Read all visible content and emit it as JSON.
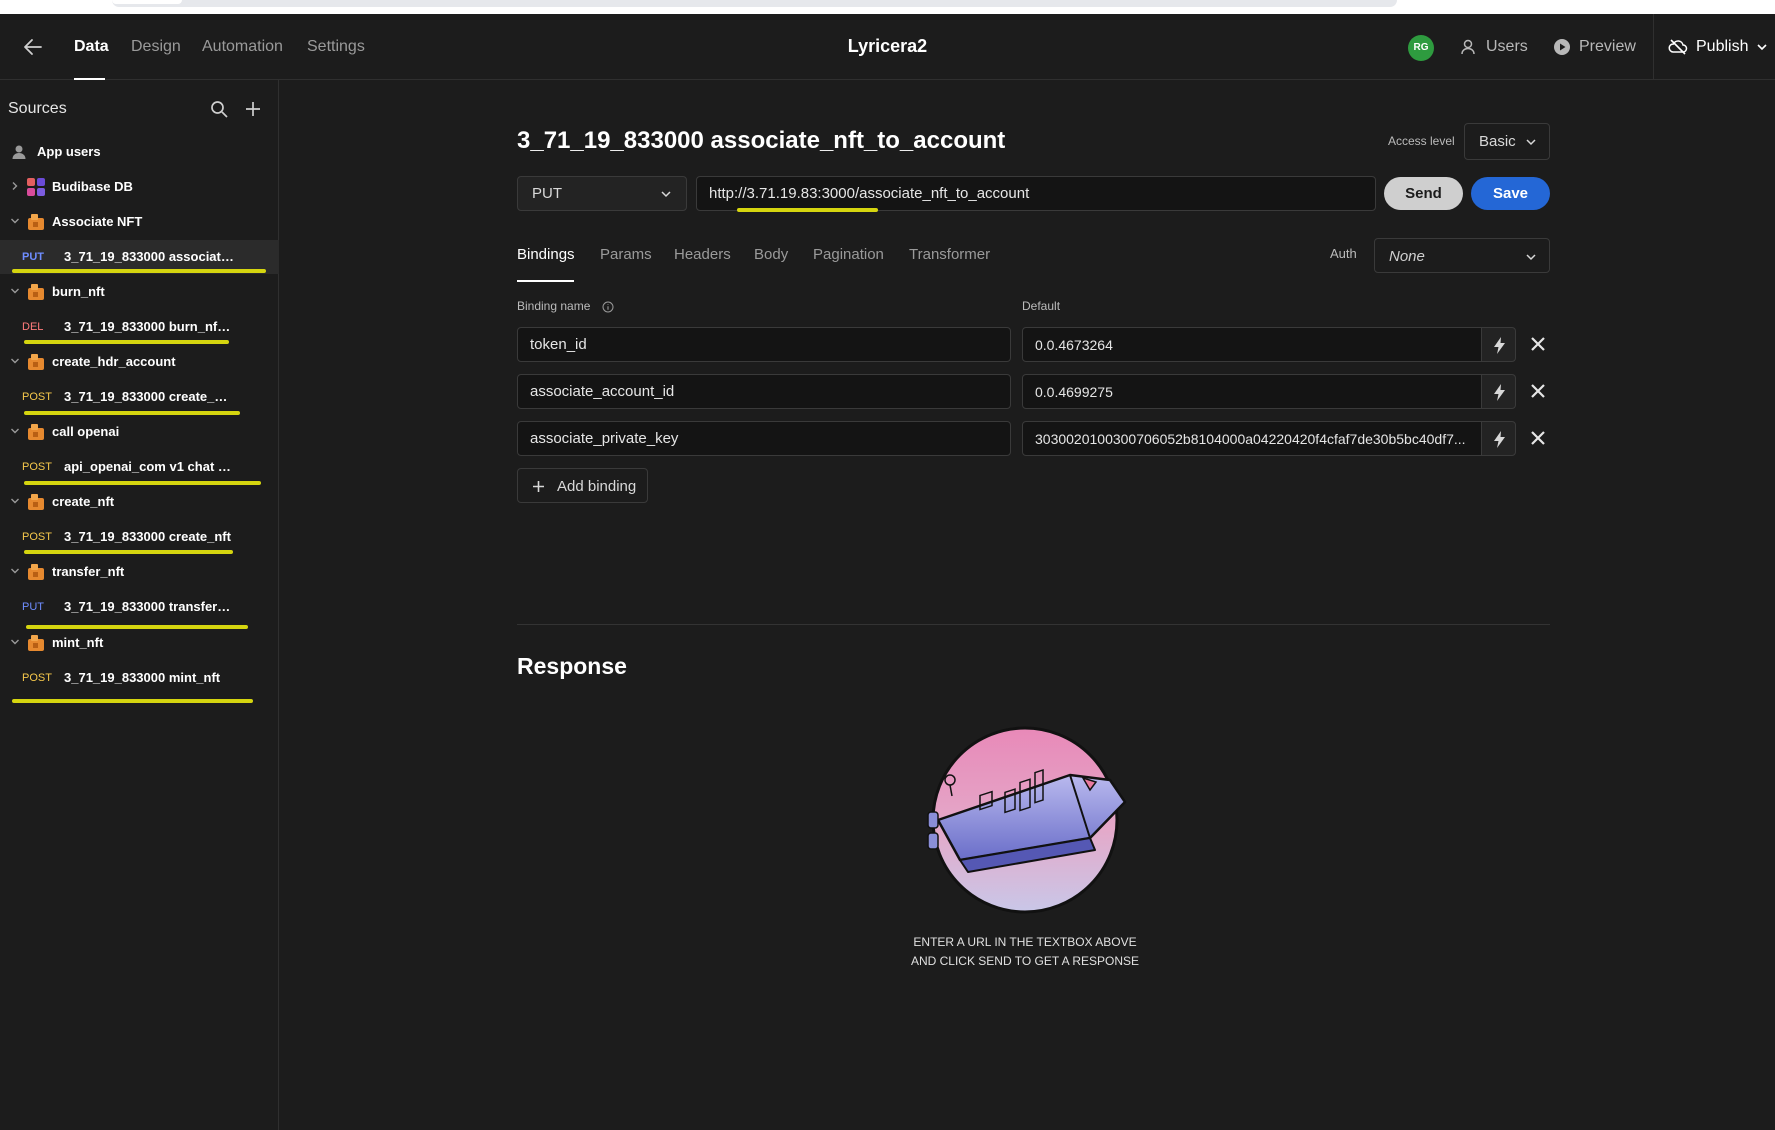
{
  "header": {
    "tabs": [
      "Data",
      "Design",
      "Automation",
      "Settings"
    ],
    "active_tab": "Data",
    "app_title": "Lyricera2",
    "avatar_initials": "RG",
    "users_label": "Users",
    "preview_label": "Preview",
    "publish_label": "Publish"
  },
  "sidebar": {
    "title": "Sources",
    "app_users": "App users",
    "datasources": [
      {
        "name": "Budibase DB",
        "expanded": false
      },
      {
        "name": "Associate NFT",
        "expanded": true,
        "query": {
          "method": "PUT",
          "name": "3_71_19_833000 associate..."
        }
      },
      {
        "name": "burn_nft",
        "expanded": true,
        "query": {
          "method": "DEL",
          "name": "3_71_19_833000 burn_nft_..."
        }
      },
      {
        "name": "create_hdr_account",
        "expanded": true,
        "query": {
          "method": "POST",
          "name": "3_71_19_833000 create_ac..."
        }
      },
      {
        "name": "call openai",
        "expanded": true,
        "query": {
          "method": "POST",
          "name": "api_openai_com v1 chat co..."
        }
      },
      {
        "name": "create_nft",
        "expanded": true,
        "query": {
          "method": "POST",
          "name": "3_71_19_833000 create_nft"
        }
      },
      {
        "name": "transfer_nft",
        "expanded": true,
        "query": {
          "method": "PUT",
          "name": "3_71_19_833000 transfer_n..."
        }
      },
      {
        "name": "mint_nft",
        "expanded": true,
        "query": {
          "method": "POST",
          "name": "3_71_19_833000 mint_nft"
        }
      }
    ]
  },
  "query": {
    "title": "3_71_19_833000 associate_nft_to_account",
    "access_level_label": "Access level",
    "access_level": "Basic",
    "method": "PUT",
    "url": "http://3.71.19.83:3000/associate_nft_to_account",
    "send_label": "Send",
    "save_label": "Save",
    "tabs": [
      "Bindings",
      "Params",
      "Headers",
      "Body",
      "Pagination",
      "Transformer"
    ],
    "active_tab": "Bindings",
    "auth_label": "Auth",
    "auth_value": "None",
    "binding_name_header": "Binding name",
    "default_header": "Default",
    "bindings": [
      {
        "name": "token_id",
        "default": "0.0.4673264"
      },
      {
        "name": "associate_account_id",
        "default": "0.0.4699275"
      },
      {
        "name": "associate_private_key",
        "default": "3030020100300706052b8104000a04220420f4cfaf7de30b5bc40df7..."
      }
    ],
    "add_binding_label": "Add binding"
  },
  "response": {
    "title": "Response",
    "empty_line1": "ENTER A URL IN THE TEXTBOX ABOVE",
    "empty_line2": "AND CLICK SEND TO GET A RESPONSE"
  },
  "colors": {
    "background": "#1c1c1c",
    "primary_button": "#2467d6",
    "method_put": "#6f8dff",
    "method_del": "#ff7b7b",
    "method_post": "#f6c84b",
    "highlight_underline": "#d5d50f"
  }
}
